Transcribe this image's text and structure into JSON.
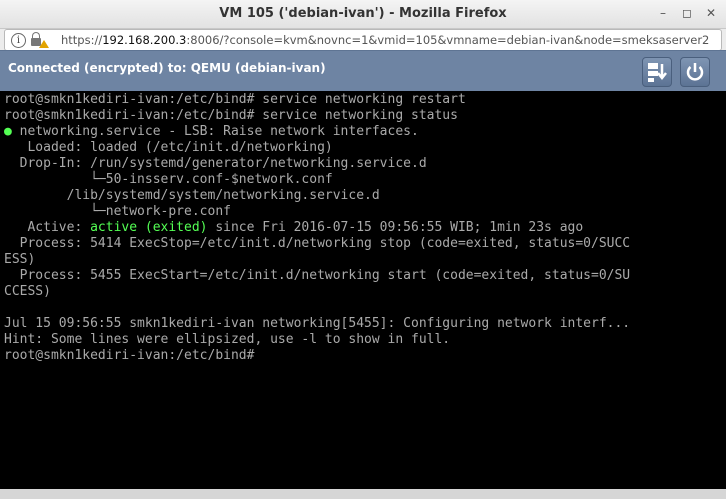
{
  "window": {
    "title": "VM 105 ('debian-ivan') - Mozilla Firefox",
    "buttons": [
      "minimize",
      "maximize",
      "close"
    ]
  },
  "browser": {
    "url_scheme": "https://",
    "url_host": "192.168.200.3",
    "url_rest": ":8006/?console=kvm&novnc=1&vmid=105&vmname=debian-ivan&node=smeksaserver2"
  },
  "novnc": {
    "status": "Connected (encrypted) to: QEMU (debian-ivan)",
    "icons": [
      "clipboard-icon",
      "power-icon"
    ]
  },
  "terminal": {
    "lines": [
      {
        "text": "root@smkn1kediri-ivan:/etc/bind# service networking restart"
      },
      {
        "text": "root@smkn1kediri-ivan:/etc/bind# service networking status"
      },
      {
        "prefix": "●",
        "text": " networking.service - LSB: Raise network interfaces."
      },
      {
        "text": "   Loaded: loaded (/etc/init.d/networking)"
      },
      {
        "text": "  Drop-In: /run/systemd/generator/networking.service.d"
      },
      {
        "text": "           └─50-insserv.conf-$network.conf"
      },
      {
        "text": "        /lib/systemd/system/networking.service.d"
      },
      {
        "text": "           └─network-pre.conf"
      },
      {
        "text_before": "   Active: ",
        "highlight": "active (exited)",
        "text": " since Fri 2016-07-15 09:56:55 WIB; 1min 23s ago"
      },
      {
        "text": "  Process: 5414 ExecStop=/etc/init.d/networking stop (code=exited, status=0/SUCC"
      },
      {
        "text": "ESS)"
      },
      {
        "text": "  Process: 5455 ExecStart=/etc/init.d/networking start (code=exited, status=0/SU"
      },
      {
        "text": "CCESS)"
      },
      {
        "text": ""
      },
      {
        "text": "Jul 15 09:56:55 smkn1kediri-ivan networking[5455]: Configuring network interf..."
      },
      {
        "text": "Hint: Some lines were ellipsized, use -l to show in full."
      },
      {
        "text": "root@smkn1kediri-ivan:/etc/bind#"
      }
    ]
  }
}
